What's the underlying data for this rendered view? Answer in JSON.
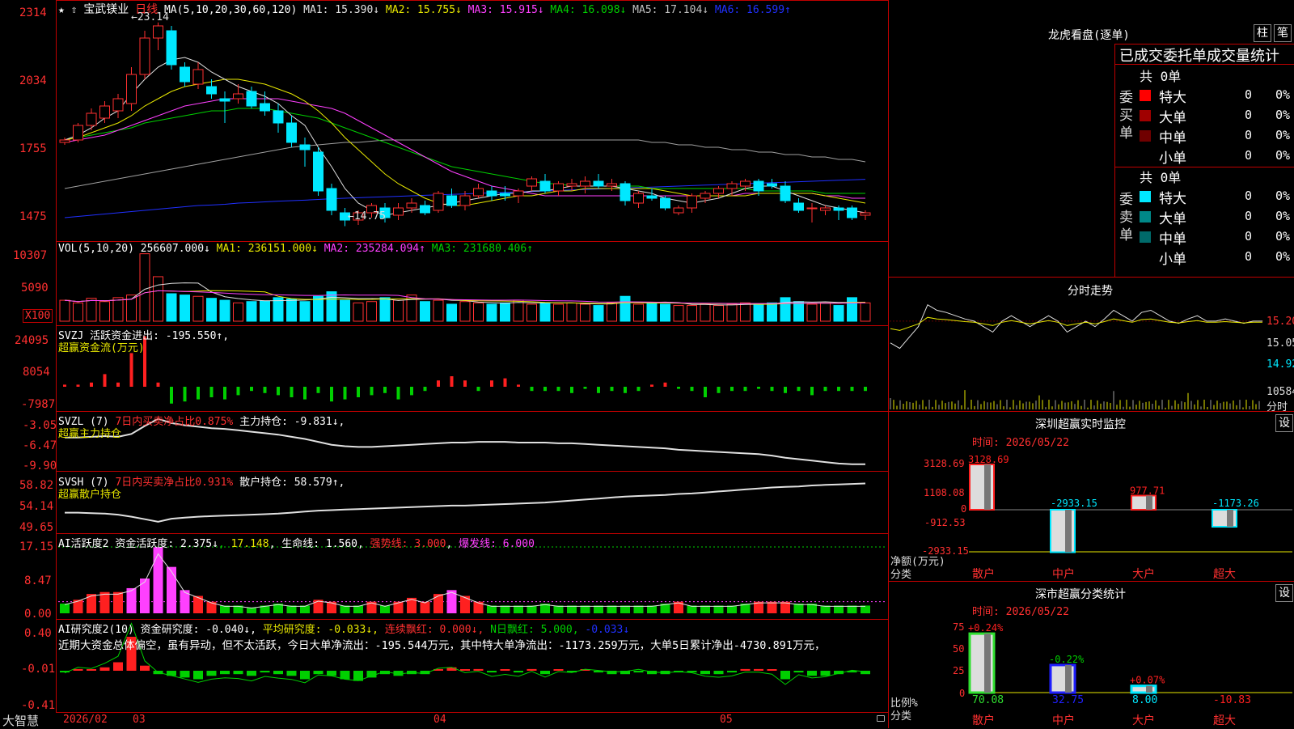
{
  "colors": {
    "up": "#ff3030",
    "down": "#00e8ff",
    "axis": "#c00000",
    "white": "#e0e0e0",
    "yellow": "#e8e800",
    "magenta": "#ff40ff",
    "green": "#00d000",
    "blue": "#2030ff",
    "gray": "#a0a0a0",
    "red": "#ff2020"
  },
  "main": {
    "stock_name": "宝武镁业",
    "period": "日线",
    "header_prefix": "MA(5,10,20,30,60,120)",
    "ma": [
      {
        "label": "MA1: 15.390↓",
        "color": "#e0e0e0"
      },
      {
        "label": "MA2: 15.755↓",
        "color": "#e8e800"
      },
      {
        "label": "MA3: 15.915↓",
        "color": "#ff40ff"
      },
      {
        "label": "MA4: 16.098↓",
        "color": "#00d000"
      },
      {
        "label": "MA5: 17.104↓",
        "color": "#c0c0c0"
      },
      {
        "label": "MA6: 16.599↑",
        "color": "#2030ff"
      }
    ],
    "y_ticks": [
      "2314",
      "2034",
      "1755",
      "1475"
    ],
    "y_range": [
      14.2,
      23.6
    ],
    "high_label": "23.14",
    "low_label": "14.75",
    "candles": [
      [
        18.2,
        18.4,
        18.1,
        18.3
      ],
      [
        18.3,
        19.0,
        18.2,
        18.9
      ],
      [
        18.9,
        19.6,
        18.7,
        19.4
      ],
      [
        19.2,
        19.9,
        19.0,
        19.7
      ],
      [
        19.5,
        20.2,
        19.2,
        20.0
      ],
      [
        19.8,
        21.3,
        19.5,
        21.0
      ],
      [
        21.0,
        22.8,
        20.8,
        22.5
      ],
      [
        22.5,
        23.14,
        22.0,
        23.0
      ],
      [
        22.8,
        23.0,
        21.2,
        21.4
      ],
      [
        21.3,
        21.5,
        20.5,
        20.7
      ],
      [
        20.6,
        21.5,
        20.4,
        21.2
      ],
      [
        20.5,
        20.8,
        20.0,
        20.2
      ],
      [
        20.0,
        20.3,
        19.0,
        19.9
      ],
      [
        20.0,
        20.6,
        19.8,
        20.2
      ],
      [
        20.3,
        20.5,
        19.6,
        19.7
      ],
      [
        19.8,
        20.3,
        19.3,
        19.5
      ],
      [
        19.5,
        19.8,
        18.6,
        19.0
      ],
      [
        19.0,
        19.3,
        18.0,
        18.2
      ],
      [
        18.1,
        18.4,
        17.2,
        17.9
      ],
      [
        17.8,
        18.0,
        16.0,
        16.2
      ],
      [
        16.3,
        16.5,
        15.2,
        15.4
      ],
      [
        15.3,
        15.5,
        14.75,
        15.0
      ],
      [
        15.0,
        15.4,
        14.8,
        15.3
      ],
      [
        15.3,
        15.7,
        15.1,
        15.6
      ],
      [
        15.5,
        15.7,
        14.9,
        15.1
      ],
      [
        15.2,
        15.7,
        15.0,
        15.5
      ],
      [
        15.5,
        15.9,
        15.3,
        15.7
      ],
      [
        15.6,
        15.8,
        15.2,
        15.3
      ],
      [
        15.4,
        16.2,
        15.3,
        16.1
      ],
      [
        16.0,
        16.3,
        15.5,
        15.6
      ],
      [
        15.6,
        16.2,
        15.4,
        16.0
      ],
      [
        16.0,
        16.5,
        15.9,
        16.3
      ],
      [
        16.2,
        16.4,
        15.8,
        16.0
      ],
      [
        16.1,
        16.4,
        15.8,
        16.0
      ],
      [
        16.0,
        16.3,
        15.7,
        16.2
      ],
      [
        16.4,
        16.8,
        16.2,
        16.7
      ],
      [
        16.6,
        16.9,
        16.1,
        16.2
      ],
      [
        16.2,
        16.6,
        16.0,
        16.5
      ],
      [
        16.4,
        16.7,
        16.2,
        16.5
      ],
      [
        16.4,
        16.8,
        16.1,
        16.6
      ],
      [
        16.6,
        16.9,
        16.3,
        16.4
      ],
      [
        16.4,
        16.7,
        16.2,
        16.5
      ],
      [
        16.5,
        16.6,
        15.6,
        15.8
      ],
      [
        15.7,
        16.2,
        15.5,
        16.1
      ],
      [
        16.0,
        16.3,
        15.8,
        15.9
      ],
      [
        15.9,
        16.0,
        15.4,
        15.5
      ],
      [
        15.3,
        15.6,
        15.2,
        15.5
      ],
      [
        15.5,
        16.1,
        15.3,
        16.0
      ],
      [
        15.9,
        16.2,
        15.7,
        16.1
      ],
      [
        16.1,
        16.4,
        15.9,
        16.3
      ],
      [
        16.3,
        16.6,
        16.0,
        16.5
      ],
      [
        16.4,
        16.7,
        16.2,
        16.6
      ],
      [
        16.6,
        16.7,
        16.0,
        16.2
      ],
      [
        16.5,
        16.7,
        16.3,
        16.4
      ],
      [
        16.4,
        16.6,
        15.7,
        15.8
      ],
      [
        15.7,
        15.9,
        15.3,
        15.4
      ],
      [
        15.5,
        15.7,
        14.9,
        15.5
      ],
      [
        15.4,
        15.6,
        15.2,
        15.5
      ],
      [
        15.5,
        15.6,
        15.0,
        15.4
      ],
      [
        15.5,
        15.6,
        15.0,
        15.1
      ],
      [
        15.2,
        15.4,
        15.0,
        15.3
      ]
    ],
    "ma_lines": {
      "ma5": [
        18.3,
        18.5,
        18.8,
        19.2,
        19.5,
        20.2,
        20.8,
        21.3,
        21.6,
        21.7,
        21.5,
        21.1,
        20.8,
        20.5,
        20.3,
        20.1,
        19.8,
        19.3,
        18.9,
        18.0,
        17.2,
        16.3,
        15.7,
        15.4,
        15.2,
        15.3,
        15.4,
        15.5,
        15.6,
        15.7,
        15.8,
        15.9,
        16.0,
        16.1,
        16.1,
        16.2,
        16.2,
        16.3,
        16.4,
        16.4,
        16.4,
        16.4,
        16.3,
        16.2,
        16.1,
        15.9,
        15.8,
        15.7,
        15.8,
        15.9,
        16.1,
        16.3,
        16.4,
        16.4,
        16.2,
        16.0,
        15.8,
        15.6,
        15.5,
        15.4,
        15.3
      ],
      "ma10": [
        18.3,
        18.4,
        18.6,
        18.8,
        19.0,
        19.3,
        19.7,
        20.0,
        20.3,
        20.5,
        20.6,
        20.7,
        20.8,
        20.8,
        20.7,
        20.6,
        20.4,
        20.2,
        19.9,
        19.5,
        19.0,
        18.4,
        17.9,
        17.4,
        16.9,
        16.5,
        16.2,
        15.9,
        15.7,
        15.6,
        15.6,
        15.7,
        15.8,
        15.9,
        16.0,
        16.0,
        16.1,
        16.2,
        16.2,
        16.3,
        16.3,
        16.3,
        16.3,
        16.3,
        16.3,
        16.2,
        16.1,
        16.0,
        16.0,
        16.0,
        16.0,
        16.0,
        16.1,
        16.1,
        16.1,
        16.1,
        16.1,
        16.0,
        15.9,
        15.8,
        15.7
      ],
      "ma20": [
        18.2,
        18.3,
        18.4,
        18.5,
        18.7,
        18.9,
        19.1,
        19.3,
        19.5,
        19.7,
        19.8,
        19.9,
        20.0,
        20.0,
        20.0,
        20.0,
        20.0,
        19.9,
        19.8,
        19.7,
        19.6,
        19.4,
        19.1,
        18.8,
        18.5,
        18.2,
        17.9,
        17.6,
        17.3,
        17.0,
        16.8,
        16.6,
        16.4,
        16.3,
        16.2,
        16.1,
        16.0,
        16.0,
        16.0,
        16.0,
        16.0,
        16.0,
        16.0,
        16.0,
        16.0,
        16.0,
        16.0,
        16.0,
        16.0,
        16.0,
        16.0,
        16.1,
        16.1,
        16.1,
        16.1,
        16.1,
        16.1,
        16.0,
        16.0,
        15.9,
        15.9
      ],
      "ma30": [
        18.3,
        18.4,
        18.5,
        18.6,
        18.7,
        18.8,
        19.0,
        19.1,
        19.2,
        19.3,
        19.4,
        19.5,
        19.5,
        19.6,
        19.6,
        19.6,
        19.5,
        19.4,
        19.3,
        19.2,
        19.0,
        18.8,
        18.6,
        18.4,
        18.2,
        18.0,
        17.8,
        17.6,
        17.4,
        17.2,
        17.1,
        17.0,
        16.9,
        16.8,
        16.7,
        16.6,
        16.5,
        16.5,
        16.4,
        16.4,
        16.4,
        16.4,
        16.4,
        16.4,
        16.3,
        16.3,
        16.3,
        16.3,
        16.3,
        16.3,
        16.3,
        16.3,
        16.2,
        16.2,
        16.2,
        16.2,
        16.2,
        16.1,
        16.1,
        16.1,
        16.1
      ],
      "ma60": [
        16.3,
        16.4,
        16.5,
        16.6,
        16.7,
        16.8,
        16.9,
        17.0,
        17.1,
        17.2,
        17.3,
        17.4,
        17.5,
        17.6,
        17.7,
        17.8,
        17.9,
        18.0,
        18.05,
        18.1,
        18.15,
        18.2,
        18.2,
        18.25,
        18.3,
        18.3,
        18.3,
        18.3,
        18.3,
        18.3,
        18.3,
        18.3,
        18.3,
        18.3,
        18.3,
        18.3,
        18.3,
        18.3,
        18.3,
        18.3,
        18.3,
        18.3,
        18.3,
        18.3,
        18.2,
        18.2,
        18.1,
        18.1,
        18.0,
        18.0,
        17.9,
        17.9,
        17.8,
        17.8,
        17.7,
        17.7,
        17.6,
        17.6,
        17.5,
        17.5,
        17.4
      ],
      "ma120": [
        15.1,
        15.15,
        15.2,
        15.25,
        15.3,
        15.35,
        15.4,
        15.45,
        15.5,
        15.55,
        15.6,
        15.62,
        15.65,
        15.7,
        15.72,
        15.75,
        15.78,
        15.8,
        15.82,
        15.85,
        15.88,
        15.9,
        15.92,
        15.94,
        15.96,
        15.98,
        16.0,
        16.02,
        16.04,
        16.06,
        16.08,
        16.1,
        16.12,
        16.14,
        16.16,
        16.18,
        16.2,
        16.22,
        16.24,
        16.26,
        16.28,
        16.3,
        16.32,
        16.34,
        16.36,
        16.38,
        16.4,
        16.42,
        16.44,
        16.46,
        16.48,
        16.5,
        16.52,
        16.54,
        16.56,
        16.58,
        16.6,
        16.62,
        16.64,
        16.66,
        16.68
      ]
    }
  },
  "vol": {
    "header": "VOL(5,10,20)",
    "value": "256607.000↓",
    "ma": [
      {
        "label": "MA1: 236151.000↓",
        "color": "#e8e800"
      },
      {
        "label": "MA2: 235284.094↑",
        "color": "#ff40ff"
      },
      {
        "label": "MA3: 231680.406↑",
        "color": "#00d000"
      }
    ],
    "y_ticks": [
      "10307",
      "5090"
    ],
    "unit": "X100",
    "values": [
      3.2,
      2.8,
      3.5,
      3.0,
      3.6,
      4.0,
      10.3,
      6.8,
      4.2,
      4.0,
      3.8,
      3.5,
      3.2,
      2.8,
      3.0,
      3.1,
      3.6,
      3.4,
      3.0,
      3.8,
      4.5,
      3.2,
      2.8,
      3.0,
      3.6,
      3.2,
      4.0,
      3.0,
      3.2,
      2.6,
      3.0,
      2.8,
      2.6,
      2.8,
      3.2,
      2.6,
      2.8,
      2.6,
      2.8,
      2.6,
      2.4,
      2.8,
      3.8,
      2.6,
      2.8,
      2.6,
      2.4,
      2.4,
      2.6,
      2.4,
      2.6,
      2.8,
      2.6,
      2.8,
      3.6,
      3.0,
      2.6,
      2.8,
      2.4,
      3.6,
      2.8
    ]
  },
  "svzj": {
    "header": "SVZJ",
    "label": "活跃资金进出: -195.550↑,",
    "sub": "超赢资金流(万元)",
    "y_ticks": [
      "24095",
      "8054",
      "-7987"
    ],
    "values": [
      1,
      1,
      2,
      6,
      2,
      16,
      24,
      2,
      -8,
      -7,
      -6,
      -5,
      -6,
      -4,
      -2,
      -3,
      -4,
      -5,
      -6,
      -3,
      -7,
      -6,
      -5,
      -4,
      -3,
      -6,
      -4,
      -2,
      3,
      5,
      3,
      -2,
      3,
      4,
      1,
      -2,
      -2,
      -2,
      -3,
      -1,
      -3,
      -2,
      -3,
      -2,
      1,
      2,
      -1,
      -2,
      -5,
      -3,
      -2,
      -2,
      -1,
      -2,
      -3,
      -2,
      -4,
      -2,
      -2,
      -2,
      -2
    ]
  },
  "svzl": {
    "header": "SVZL (7)",
    "ratio": "7日内买卖净占比0.875%",
    "label": "主力持仓: -9.831↓,",
    "sub": "超赢主力持仓",
    "y_ticks": [
      "-3.05",
      "-6.47",
      "-9.90"
    ],
    "y_range": [
      -10.2,
      -2.8
    ],
    "values": [
      -5.8,
      -5.8,
      -5.7,
      -5.6,
      -5.7,
      -5.3,
      -4.2,
      -3.2,
      -3.8,
      -4.1,
      -4.3,
      -4.5,
      -4.6,
      -4.8,
      -5.0,
      -5.2,
      -5.4,
      -5.7,
      -6.0,
      -6.4,
      -6.8,
      -7.0,
      -7.1,
      -7.1,
      -7.0,
      -6.9,
      -6.8,
      -6.7,
      -6.6,
      -6.5,
      -6.5,
      -6.4,
      -6.4,
      -6.4,
      -6.5,
      -6.5,
      -6.5,
      -6.6,
      -6.6,
      -6.7,
      -6.8,
      -6.9,
      -7.0,
      -7.1,
      -7.2,
      -7.3,
      -7.5,
      -7.6,
      -7.7,
      -7.8,
      -7.9,
      -8.0,
      -8.1,
      -8.3,
      -8.6,
      -8.8,
      -9.0,
      -9.2,
      -9.4,
      -9.5,
      -9.5
    ]
  },
  "svsh": {
    "header": "SVSH (7)",
    "ratio": "7日内买卖净占比0.931%",
    "label": "散户持仓: 58.579↑,",
    "sub": "超赢散户持仓",
    "y_ticks": [
      "58.82",
      "54.14",
      "49.65"
    ],
    "y_range": [
      49.0,
      59.6
    ],
    "values": [
      52.6,
      52.6,
      52.5,
      52.4,
      52.2,
      51.8,
      51.3,
      50.8,
      51.4,
      51.6,
      51.8,
      51.9,
      52.0,
      52.1,
      52.2,
      52.3,
      52.4,
      52.6,
      52.8,
      53.0,
      53.1,
      53.2,
      53.3,
      53.4,
      53.5,
      53.6,
      53.7,
      53.8,
      53.9,
      54.0,
      54.0,
      54.1,
      54.2,
      54.3,
      54.4,
      54.5,
      54.6,
      54.8,
      55.0,
      55.2,
      55.4,
      55.6,
      55.8,
      55.9,
      56.0,
      56.1,
      56.3,
      56.4,
      56.6,
      56.8,
      57.0,
      57.2,
      57.4,
      57.6,
      57.7,
      57.8,
      58.0,
      58.1,
      58.2,
      58.3,
      58.4
    ]
  },
  "ai_active": {
    "header": "AI活跃度2",
    "label": "资金活跃度: 2.375↓",
    "v2": "17.148",
    "life": "生命线: 1.560",
    "strong": "强势线: 3.000",
    "burst": "爆发线: 6.000",
    "y_ticks": [
      "17.15",
      "8.47",
      "0.00"
    ],
    "y_max": 18,
    "values": [
      2.5,
      3.5,
      5.0,
      5.5,
      5.5,
      6.5,
      9.0,
      17.1,
      12.0,
      6.0,
      4.5,
      3.0,
      2.0,
      2.0,
      1.5,
      2.0,
      2.5,
      2.0,
      2.0,
      3.5,
      3.0,
      2.0,
      2.0,
      3.0,
      2.0,
      3.0,
      4.0,
      3.0,
      5.0,
      6.0,
      4.5,
      3.0,
      2.0,
      2.0,
      2.0,
      2.0,
      2.5,
      2.0,
      2.0,
      2.0,
      2.0,
      2.0,
      2.0,
      2.0,
      2.0,
      2.5,
      3.0,
      2.0,
      2.0,
      2.0,
      2.0,
      2.5,
      3.0,
      3.0,
      3.0,
      2.5,
      2.5,
      2.0,
      2.0,
      2.0,
      2.0
    ]
  },
  "ai_research": {
    "header": "AI研究度2(10)",
    "label": "资金研究度: -0.040↓,",
    "avg": "平均研究度: -0.033↓,",
    "red": "连续飘红: 0.000↓,",
    "nday": "N日飘红: 5.000,",
    "last": "-0.033↓",
    "note": "近期大资金总体偏空，虽有异动，但不太活跃，今日大单净流出：-195.544万元，其中特大单净流出：-1173.259万元，大单5日累计净出-4730.891万元，",
    "y_ticks": [
      "0.40",
      "-0.01",
      "-0.41"
    ],
    "values": [
      -0.01,
      0.01,
      0.0,
      0.02,
      0.05,
      0.2,
      0.03,
      -0.02,
      -0.03,
      -0.04,
      -0.05,
      -0.03,
      -0.02,
      -0.02,
      -0.03,
      -0.01,
      -0.02,
      -0.03,
      -0.05,
      -0.02,
      -0.03,
      -0.05,
      -0.06,
      -0.04,
      -0.02,
      -0.03,
      -0.02,
      -0.02,
      0.01,
      0.02,
      0.0,
      0.01,
      -0.01,
      0.0,
      -0.01,
      0.01,
      -0.02,
      0.0,
      -0.01,
      0.0,
      -0.01,
      -0.02,
      -0.02,
      -0.01,
      -0.02,
      -0.02,
      -0.01,
      -0.01,
      -0.02,
      -0.02,
      -0.01,
      0.01,
      0.01,
      0.0,
      -0.05,
      -0.01,
      -0.03,
      -0.03,
      -0.02,
      -0.01,
      -0.02
    ]
  },
  "x_axis": {
    "labels": [
      "2026/02",
      "03",
      "04",
      "05"
    ],
    "brand": "大智慧"
  },
  "right": {
    "lhb_title": "龙虎看盘(逐单)",
    "btn_col": "柱",
    "btn_pen": "笔",
    "stat_title": "已成交委托单成交量统计",
    "buy_label": "委买单",
    "sell_label": "委卖单",
    "total": "共 0单",
    "buy_rows": [
      {
        "name": "特大",
        "color": "#ff0000",
        "n": "0",
        "p": "0%"
      },
      {
        "name": "大单",
        "color": "#a00000",
        "n": "0",
        "p": "0%"
      },
      {
        "name": "中单",
        "color": "#700000",
        "n": "0",
        "p": "0%"
      },
      {
        "name": "小单",
        "color": "",
        "n": "0",
        "p": "0%"
      }
    ],
    "sell_rows": [
      {
        "name": "特大",
        "color": "#00e8ff",
        "n": "0",
        "p": "0%"
      },
      {
        "name": "大单",
        "color": "#008888",
        "n": "0",
        "p": "0%"
      },
      {
        "name": "中单",
        "color": "#006a6a",
        "n": "0",
        "p": "0%"
      },
      {
        "name": "小单",
        "color": "",
        "n": "0",
        "p": "0%"
      }
    ],
    "intraday_title": "分时走势",
    "intraday_ticks": [
      "15.20",
      "15.05",
      "14.92",
      "10584",
      "分时"
    ],
    "intraday_line": [
      15.0,
      14.95,
      15.05,
      15.15,
      15.35,
      15.3,
      15.28,
      15.25,
      15.22,
      15.2,
      15.15,
      15.1,
      15.2,
      15.25,
      15.2,
      15.15,
      15.2,
      15.25,
      15.2,
      15.1,
      15.15,
      15.2,
      15.15,
      15.22,
      15.3,
      15.25,
      15.2,
      15.28,
      15.3,
      15.25,
      15.2,
      15.18,
      15.22,
      15.25,
      15.2,
      15.2,
      15.22,
      15.2,
      15.18,
      15.2,
      15.2
    ],
    "sz_title": "深圳超赢实时监控",
    "set": "设",
    "time_label": "时间: 2026/05/22",
    "sz_ticks": [
      "3128.69",
      "1108.08",
      "0",
      "-912.53",
      "-2933.15"
    ],
    "sz_axis_label": "净额(万元)",
    "cat_label": "分类",
    "sz_bars": [
      {
        "cat": "散户",
        "value": 3128.69,
        "label": "3128.69"
      },
      {
        "cat": "中户",
        "value": -2933.15,
        "label": "-2933.15"
      },
      {
        "cat": "大户",
        "value": 977.71,
        "label": "977.71"
      },
      {
        "cat": "超大",
        "value": -1173.26,
        "label": "-1173.26"
      }
    ],
    "class_title": "深市超赢分类统计",
    "class_ticks": [
      "75",
      "50",
      "25",
      "0"
    ],
    "ratio_label": "比例%",
    "class_bars": [
      {
        "cat": "散户",
        "value": 70.08,
        "chg": "+0.24%",
        "color": "#30e030"
      },
      {
        "cat": "中户",
        "value": 32.75,
        "chg": "-0.22%",
        "color": "#2020ff"
      },
      {
        "cat": "大户",
        "value": 8.0,
        "chg": "+0.07%",
        "color": "#00e8ff"
      },
      {
        "cat": "超大",
        "value": -10.83,
        "chg": "",
        "color": "#ff2020"
      }
    ],
    "class_vals": [
      "70.08",
      "32.75",
      "8.00",
      "-10.83"
    ]
  }
}
